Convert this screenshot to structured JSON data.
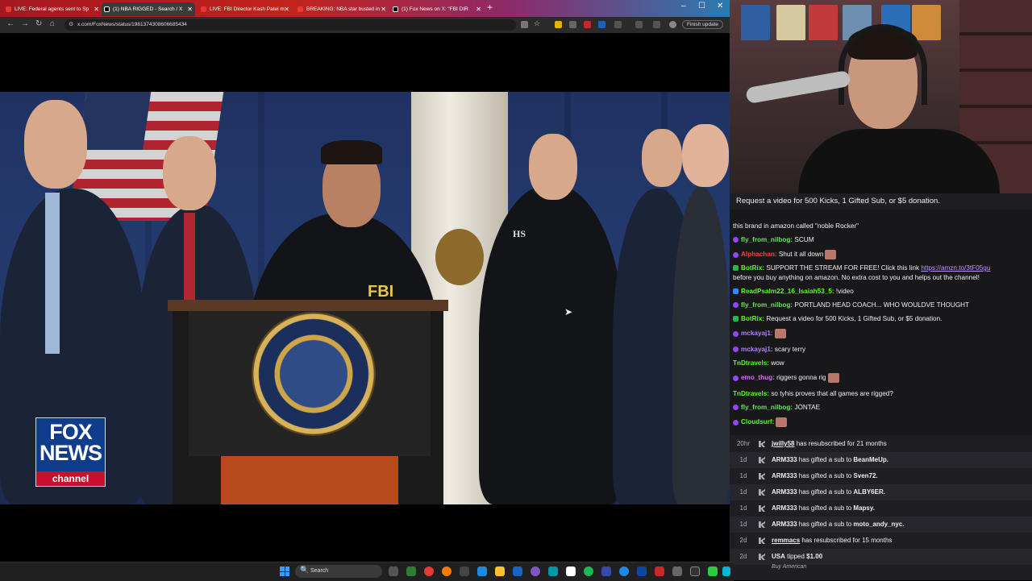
{
  "browser": {
    "tabs": [
      {
        "label": "LIVE: Federal agents sent to Sp"
      },
      {
        "label": "(1) NBA RIGGED - Search / X"
      },
      {
        "label": "LIVE: FBI Director Kash Patel m"
      },
      {
        "label": "BREAKING: NBA star busted in"
      },
      {
        "label": "(1) Fox News on X: \"FBI DIR"
      }
    ],
    "new_tab_label": "+",
    "window_controls": {
      "minimize": "–",
      "maximize": "☐",
      "close": "✕"
    },
    "url": "x.com/FoxNews/status/1981374308606685434",
    "finish_update_label": "Finish update",
    "nav": {
      "back": "←",
      "forward": "→",
      "reload": "↻",
      "home": "⌂"
    }
  },
  "video": {
    "fbi_text": "FBI",
    "hs_text": "HS",
    "fox_logo": {
      "line1": "FOX",
      "line2": "NEWS",
      "line3": "channel"
    },
    "cursor": "➤"
  },
  "chat": {
    "pinned": "Request a video for 500 Kicks, 1 Gifted Sub, or $5 donation.",
    "lines": [
      {
        "user": "",
        "text": "this brand in amazon called \"noble Rocker\"",
        "color": "#efeff1",
        "badge": "none"
      },
      {
        "user": "fly_from_nilbog:",
        "text": " SCUM",
        "color": "#6dde5d",
        "badge": "purple"
      },
      {
        "user": "Alphachan:",
        "text": " Shut it all down",
        "color": "#ff3b3b",
        "badge": "purple",
        "emote": true
      },
      {
        "user": "BotRix:",
        "text": " SUPPORT THE STREAM FOR FREE! Click this link ",
        "link": "https://amzn.to/3tF05gu",
        "color": "#53fc18",
        "badge": "green"
      },
      {
        "user": "",
        "text": "before you buy anything on amazon. No extra cost to you and helps out the channel!",
        "color": "#efeff1",
        "badge": "none"
      },
      {
        "user": "ReadPsalm22_16_Isaiah53_5:",
        "text": " !video",
        "color": "#53fc18",
        "badge": "blue"
      },
      {
        "user": "fly_from_nilbog:",
        "text": " PORTLAND HEAD COACH... WHO WOULDVE THOUGHT",
        "color": "#6dde5d",
        "badge": "purple"
      },
      {
        "user": "BotRix:",
        "text": " Request a video for 500 Kicks, 1 Gifted Sub, or $5 donation.",
        "color": "#53fc18",
        "badge": "green"
      },
      {
        "user": "mckayaj1:",
        "text": "",
        "color": "#b37cff",
        "badge": "purple",
        "emote": true
      },
      {
        "user": "mckayaj1:",
        "text": " scary terry",
        "color": "#b37cff",
        "badge": "purple"
      },
      {
        "user": "TnDtravels:",
        "text": " wow",
        "color": "#53fc18",
        "badge": "none"
      },
      {
        "user": "emo_thug:",
        "text": " riggers gonna rig",
        "color": "#d36cff",
        "badge": "purple",
        "emote": true
      },
      {
        "user": "TnDtravels:",
        "text": " so tyhis proves that all games are rigged?",
        "color": "#53fc18",
        "badge": "none"
      },
      {
        "user": "fly_from_nilbog:",
        "text": " JONTAE",
        "color": "#6dde5d",
        "badge": "purple"
      },
      {
        "user": "Cloudsurf:",
        "text": "",
        "color": "#53fc18",
        "badge": "purple",
        "emote": true
      }
    ]
  },
  "feed": {
    "rows": [
      {
        "time": "20hr",
        "user": "jwilly58",
        "text": " has resubscribed for 21 months",
        "underline": true
      },
      {
        "time": "1d",
        "user": "ARM333",
        "text": " has gifted a sub to ",
        "target": "BeanMeUp."
      },
      {
        "time": "1d",
        "user": "ARM333",
        "text": " has gifted a sub to ",
        "target": "Sven72."
      },
      {
        "time": "1d",
        "user": "ARM333",
        "text": " has gifted a sub to ",
        "target": "ALBY6ER."
      },
      {
        "time": "1d",
        "user": "ARM333",
        "text": " has gifted a sub to ",
        "target": "Mapsy."
      },
      {
        "time": "1d",
        "user": "ARM333",
        "text": " has gifted a sub to ",
        "target": "moto_andy_nyc."
      },
      {
        "time": "2d",
        "user": "remmacs",
        "text": " has resubscribed for 15 months",
        "underline": true
      },
      {
        "time": "2d",
        "user": "USA",
        "text": " tipped ",
        "target": "$1.00",
        "sub": "Buy American"
      }
    ]
  },
  "taskbar": {
    "search_label": "Search",
    "search_icon": "🔍"
  }
}
